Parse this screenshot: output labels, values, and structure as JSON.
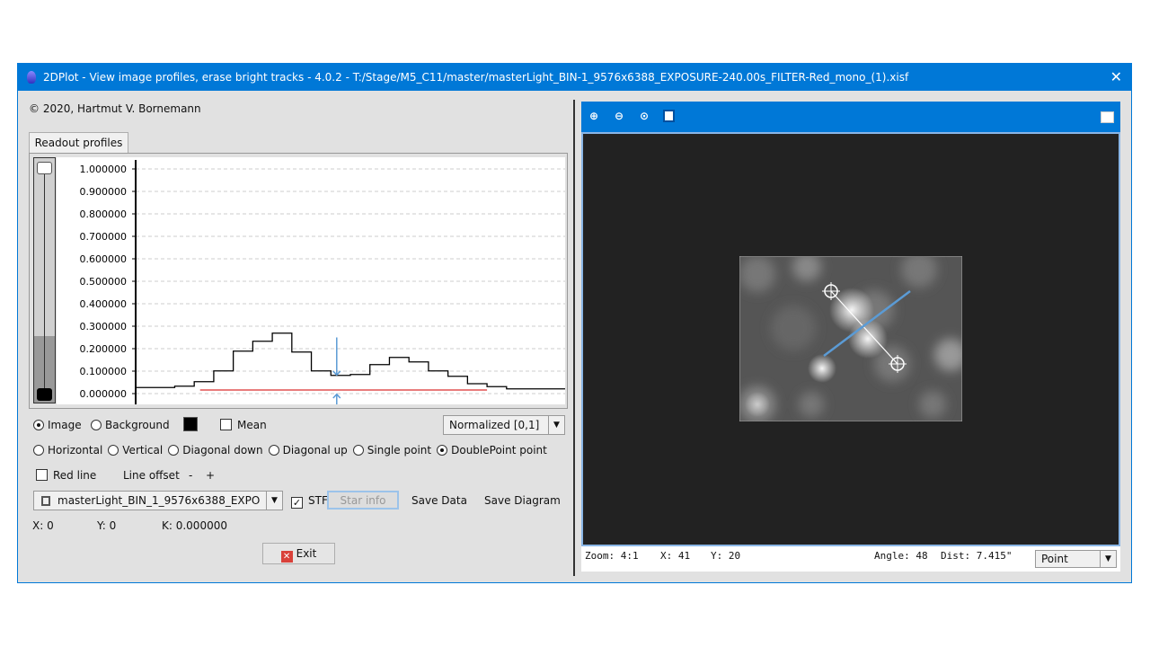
{
  "window": {
    "title": "2DPlot - View image profiles, erase bright tracks - 4.0.2 - T:/Stage/M5_C11/master/masterLight_BIN-1_9576x6388_EXPOSURE-240.00s_FILTER-Red_mono_(1).xisf",
    "close": "✕"
  },
  "copyright": "© 2020, Hartmut V. Bornemann",
  "tab": "Readout profiles",
  "chart_data": {
    "type": "line",
    "step": true,
    "yticks": [
      "1.000000",
      "0.900000",
      "0.800000",
      "0.700000",
      "0.600000",
      "0.500000",
      "0.400000",
      "0.300000",
      "0.200000",
      "0.100000",
      "0.000000"
    ],
    "ylim": [
      0,
      1
    ],
    "grid": true,
    "series": [
      {
        "values": [
          0.027,
          0.027,
          0.033,
          0.053,
          0.101,
          0.189,
          0.233,
          0.269,
          0.185,
          0.101,
          0.081,
          0.085,
          0.129,
          0.161,
          0.141,
          0.101,
          0.077,
          0.044,
          0.031,
          0.021,
          0.021,
          0.021
        ],
        "color": "#000000"
      }
    ],
    "red_line": {
      "value": 0.016,
      "color": "#e05050"
    },
    "marker_color": "#5b9bd5"
  },
  "options": {
    "image": "Image",
    "background": "Background",
    "mean": "Mean",
    "normalization": "Normalized [0,1]",
    "directions": [
      "Horizontal",
      "Vertical",
      "Diagonal down",
      "Diagonal up",
      "Single point",
      "DoublePoint point"
    ],
    "selected_direction": 5,
    "red_line": "Red line",
    "line_offset": "Line offset",
    "minus": "-",
    "plus": "+"
  },
  "view_select": "masterLight_BIN_1_9576x6388_EXPO",
  "stf": "STF",
  "star_info": "Star info",
  "save_data": "Save Data",
  "save_diagram": "Save Diagram",
  "readout": {
    "x": "X: 0",
    "y": "Y: 0",
    "k": "K: 0.000000"
  },
  "exit": "Exit",
  "status": {
    "zoom": "Zoom: 4:1",
    "x": "X: 41",
    "y": "Y: 20",
    "angle": "Angle: 48",
    "dist": "Dist: 7.415\"",
    "mode": "Point"
  },
  "colors": {
    "accent": "#0078d7",
    "image_bg": "#222222"
  }
}
